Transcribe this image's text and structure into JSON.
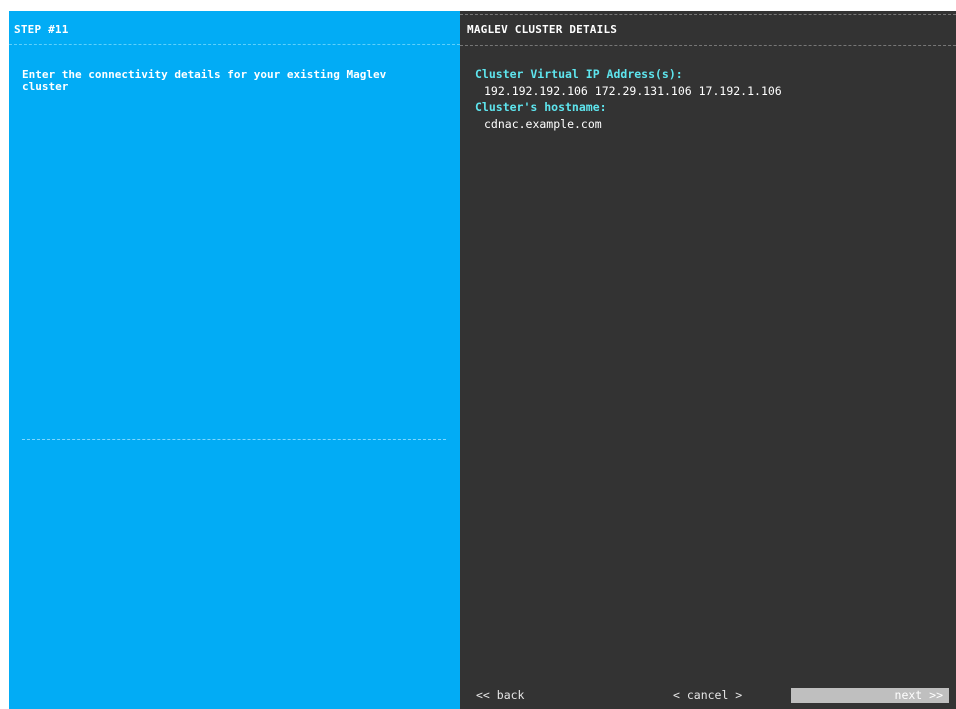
{
  "left_panel": {
    "step_title": "STEP #11",
    "description": "Enter the connectivity details for your existing Maglev cluster"
  },
  "right_panel": {
    "title": "MAGLEV CLUSTER DETAILS",
    "fields": [
      {
        "label": "Cluster Virtual IP Address(s):",
        "value": "192.192.192.106 172.29.131.106 17.192.1.106"
      },
      {
        "label": "Cluster's hostname:",
        "value": "cdnac.example.com"
      }
    ]
  },
  "buttons": {
    "back": "<< back",
    "cancel": "< cancel >",
    "next": "next >>"
  },
  "colors": {
    "left_background": "#02acf5",
    "right_background": "#333333",
    "label_color": "#5ee5ee",
    "next_button": "#bfbfbf"
  }
}
